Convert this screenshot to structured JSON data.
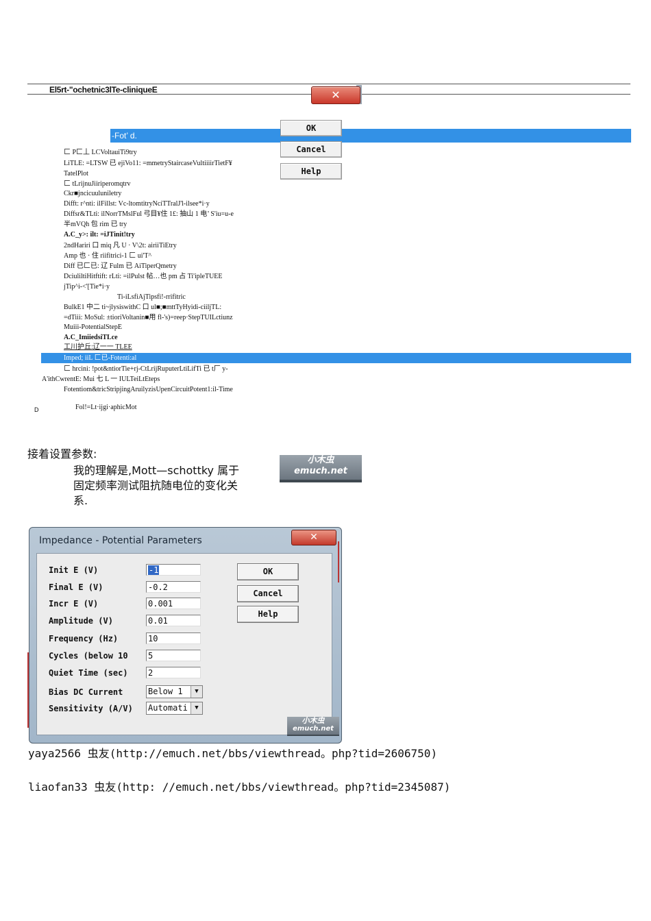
{
  "technique_dialog": {
    "title": "El5rt-\"ochetnic3lTe-cliniqueE",
    "close_glyph": "✕",
    "filter_text": "-Fot’ d.",
    "ok_label": "OK",
    "cancel_label": "Cancel",
    "help_label": "Help",
    "lines": [
      "匚 P匚丄 LCVoltauiTi9try",
      "LiTLE: =LTSW 已 ejiVo11: =mmetryStaircaseVultiiiirTietF¥",
      "TatelPlot",
      "匚 tLrijnuJiiriperomqtrv",
      "Ckr■jncicuuluniletry",
      "Difft: r^nti: ilFillst: Vc-ltomtitryNciTTralJ'l-ilsee*i·y",
      "Diffsr&TLti: ilNorrTMslFul 弓目¥住 1£: 抽山 1 电’ S'iu=u-e",
      "半mVQh 包 rim 已 try",
      "A.C_y>: ilt: =iJTinit!try",
      "2ndHariri 口 miq 凡 U · V\\2t: airiiTiEtry",
      "Amp 也 · 住 riifitrici-1 匚 ui'T^",
      "Diff 已匚已: 辽 Fulm 已 AiTiperQmetry",
      "DciuliltiHitftift: rLti: =ilPulst 帖…也 pm 占 Ti'ipleTUEE",
      "jTip^i-<'[Tie*i·y",
      "Ti-iLsfiAjTipsfi!-rrifitric",
      "BulkE1 中二 ti~jlysiswithC 口 ul■;■mttTyHyidi-ciiljTL:",
      "=dTiii: MoSul: ±tioriVoltanin■用 fl-'s)=reep·StepTUILctiunz",
      "Muiii-PotentialStepE",
      "A.C_ImiiedsiTLce",
      "工川护丘:辽一一 TLEE",
      "Imped; iiL 匚已-Fotenti:al",
      "匚 hrcini: !pot&ntiorTie+rj-CtLrijRuputerLtiLifTi 已 t厂 y-",
      "A'ithCwrentE: Mui 七 L 一 IULTeiLtEteps",
      "Fotentiom&tricStripjingAruilyzisUpenCircuitPotent1:il-Time",
      "Fol!=Lt·ijgi·aphicMot"
    ],
    "stray_letter": "D"
  },
  "notes": {
    "heading": "接着设置参数:",
    "explanation_line1": "我的理解是,Mott—schottky 属于",
    "explanation_line2": "固定频率测试阻抗随电位的变化关",
    "explanation_line3": "系."
  },
  "watermark": {
    "line1": "小木虫",
    "line2": "emuch.net"
  },
  "impedance_dialog": {
    "title": "Impedance - Potential Parameters",
    "close_glyph": "✕",
    "ok_label": "OK",
    "cancel_label": "Cancel",
    "help_label": "Help",
    "params": [
      {
        "label": "Init E (V)",
        "value": "-1"
      },
      {
        "label": "Final E (V)",
        "value": "-0.2"
      },
      {
        "label": "Incr E (V)",
        "value": "0.001"
      },
      {
        "label": "Amplitude (V)",
        "value": "0.01"
      },
      {
        "label": "Frequency (Hz)",
        "value": "10"
      },
      {
        "label": "Cycles (below 10",
        "value": "5"
      },
      {
        "label": "Quiet Time (sec)",
        "value": "2"
      }
    ],
    "bias_label": "Bias DC Current",
    "bias_value": "Below 1",
    "sensitivity_label": "Sensitivity (A/V)",
    "sensitivity_value": "Automati",
    "dropdown_glyph": "▼"
  },
  "sources": [
    "yaya2566 虫友(http://emuch.net/bbs/viewthread。php?tid=2606750)",
    "liaofan33 虫友(http: //emuch.net/bbs/viewthread。php?tid=2345087)"
  ]
}
